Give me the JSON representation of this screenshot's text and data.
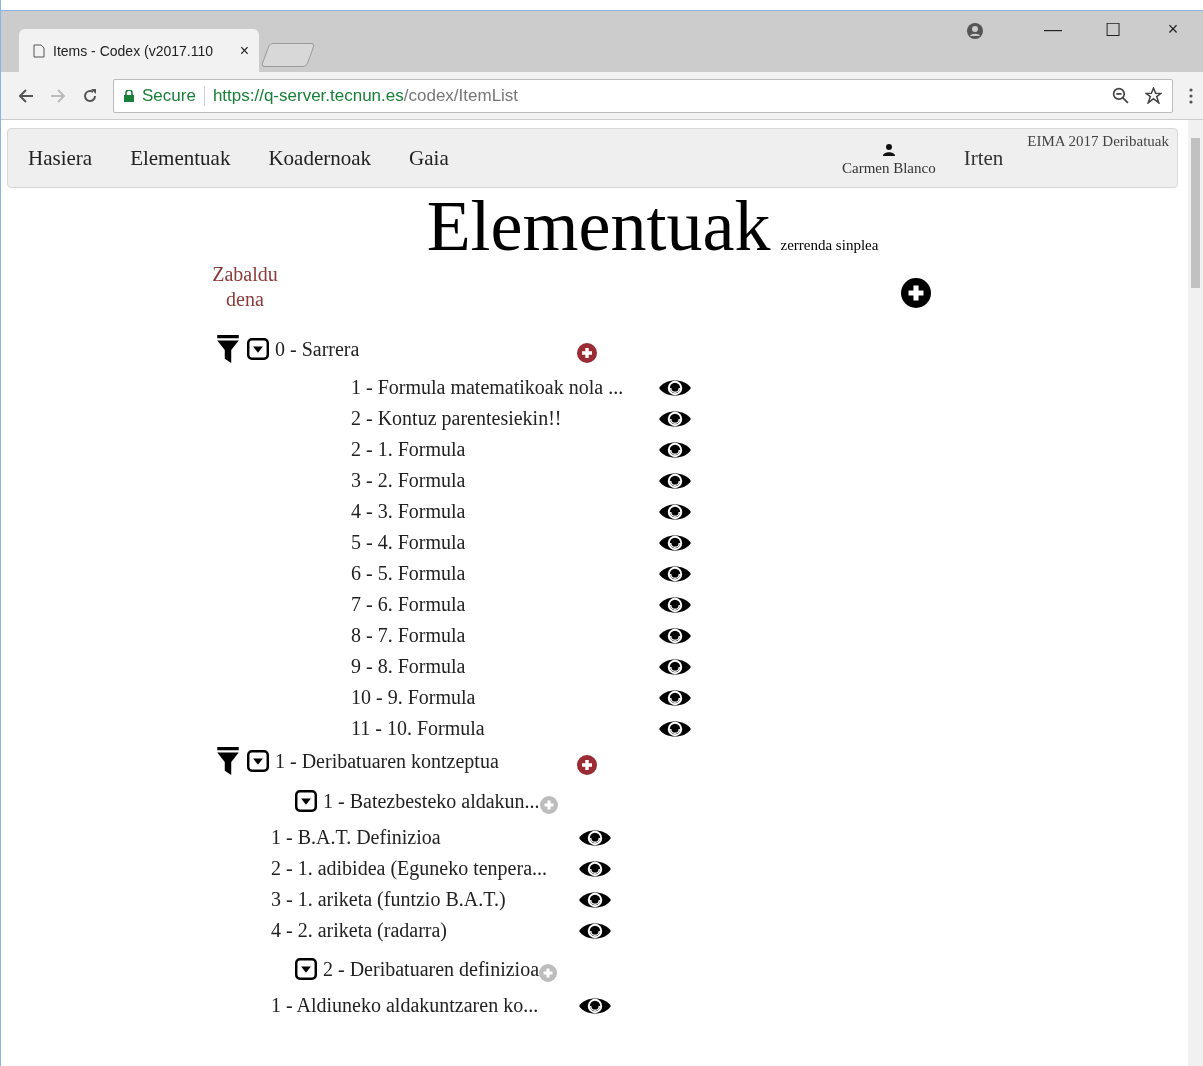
{
  "browser": {
    "tab_title": "Items - Codex (v2017.110",
    "tab_close": "×",
    "secure_label": "Secure",
    "url_host": "https://q-server.tecnun.es",
    "url_path": "/codex/ItemList",
    "window_controls": {
      "minimize": "—",
      "maximize": "☐",
      "close": "×"
    }
  },
  "nav": {
    "items": [
      {
        "label": "Hasiera"
      },
      {
        "label": "Elementuak"
      },
      {
        "label": "Koadernoak"
      },
      {
        "label": "Gaia"
      }
    ],
    "user": "Carmen Blanco",
    "logout": "Irten",
    "course": "EIMA 2017 Deribatuak"
  },
  "heading": {
    "title": "Elementuak",
    "subtitle": "zerrenda sinplea"
  },
  "expand_all": "Zabaldu dena",
  "tree": [
    {
      "kind": "section",
      "label": "0 - Sarrera",
      "expanded": true,
      "children": [
        {
          "kind": "item",
          "label": "1 - Formula matematikoak nola ..."
        },
        {
          "kind": "item",
          "label": "2 - Kontuz parentesiekin!!"
        },
        {
          "kind": "item",
          "label": "2 - 1. Formula"
        },
        {
          "kind": "item",
          "label": "3 - 2. Formula"
        },
        {
          "kind": "item",
          "label": "4 - 3. Formula"
        },
        {
          "kind": "item",
          "label": "5 - 4. Formula"
        },
        {
          "kind": "item",
          "label": "6 - 5. Formula"
        },
        {
          "kind": "item",
          "label": "7 - 6. Formula"
        },
        {
          "kind": "item",
          "label": "8 - 7. Formula"
        },
        {
          "kind": "item",
          "label": "9 - 8. Formula"
        },
        {
          "kind": "item",
          "label": "10 - 9. Formula"
        },
        {
          "kind": "item",
          "label": "11 - 10. Formula"
        }
      ]
    },
    {
      "kind": "section",
      "label": "1 - Deribatuaren kontzeptua",
      "expanded": true,
      "children": [
        {
          "kind": "subsection",
          "label": "1 - Batezbesteko aldakun...",
          "expanded": true,
          "children": [
            {
              "kind": "item",
              "label": "1 - B.A.T. Definizioa"
            },
            {
              "kind": "item",
              "label": "2 - 1. adibidea (Eguneko tenpera..."
            },
            {
              "kind": "item",
              "label": "3 - 1. ariketa (funtzio B.A.T.)"
            },
            {
              "kind": "item",
              "label": "4 - 2. ariketa (radarra)"
            }
          ]
        },
        {
          "kind": "subsection",
          "label": "2 - Deribatuaren definizioa",
          "expanded": true,
          "children": [
            {
              "kind": "item",
              "label": "1 - Aldiuneko aldakuntzaren ko..."
            }
          ]
        }
      ]
    }
  ]
}
